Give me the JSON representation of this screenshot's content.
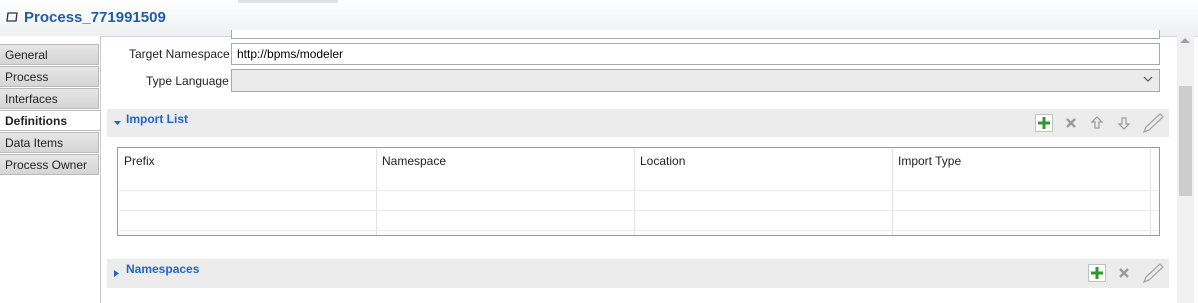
{
  "editor": {
    "title": "Process_771991509",
    "icon": "process-icon"
  },
  "tabs": [
    {
      "label": "General"
    },
    {
      "label": "Process"
    },
    {
      "label": "Interfaces"
    },
    {
      "label": "Definitions"
    },
    {
      "label": "Data Items"
    },
    {
      "label": "Process Owner"
    }
  ],
  "active_tab": "Definitions",
  "form": {
    "target_namespace_label": "Target Namespace",
    "target_namespace_value": "http://bpms/modeler",
    "type_language_label": "Type Language",
    "type_language_value": ""
  },
  "import_list": {
    "title": "Import List",
    "expanded": true,
    "columns": [
      "Prefix",
      "Namespace",
      "Location",
      "Import Type"
    ],
    "rows": []
  },
  "namespaces": {
    "title": "Namespaces",
    "expanded": false
  },
  "colors": {
    "section_title": "#1e66c9",
    "header_title": "#1f5da8",
    "add_green": "#2e9a2e"
  }
}
